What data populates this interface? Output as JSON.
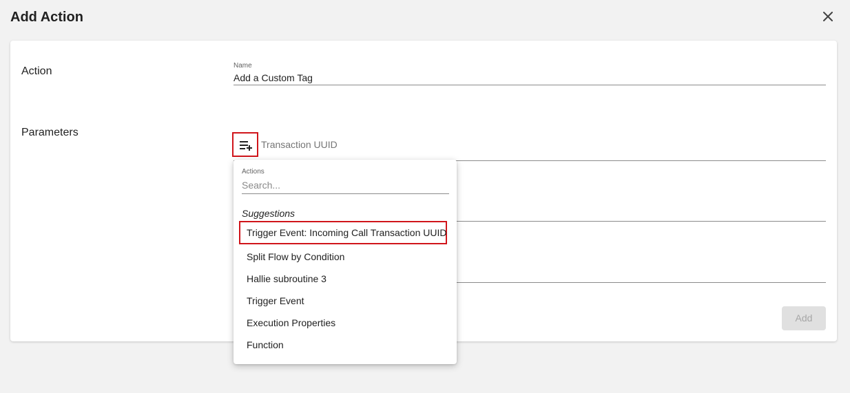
{
  "dialog": {
    "title": "Add Action"
  },
  "action_section": {
    "label": "Action",
    "name_field": {
      "label": "Name",
      "value": "Add a Custom Tag"
    }
  },
  "parameters_section": {
    "label": "Parameters",
    "first_param_placeholder": "Transaction UUID"
  },
  "dropdown": {
    "search_label": "Actions",
    "search_placeholder": "Search...",
    "heading": "Suggestions",
    "items": [
      "Trigger Event: Incoming Call Transaction UUID",
      "Split Flow by Condition",
      "Hallie subroutine 3",
      "Trigger Event",
      "Execution Properties",
      "Function"
    ]
  },
  "footer": {
    "add_label": "Add"
  },
  "colors": {
    "background": "#f2f2f2",
    "highlight_border": "#d0141a",
    "disabled_button": "#e0e0e0"
  }
}
